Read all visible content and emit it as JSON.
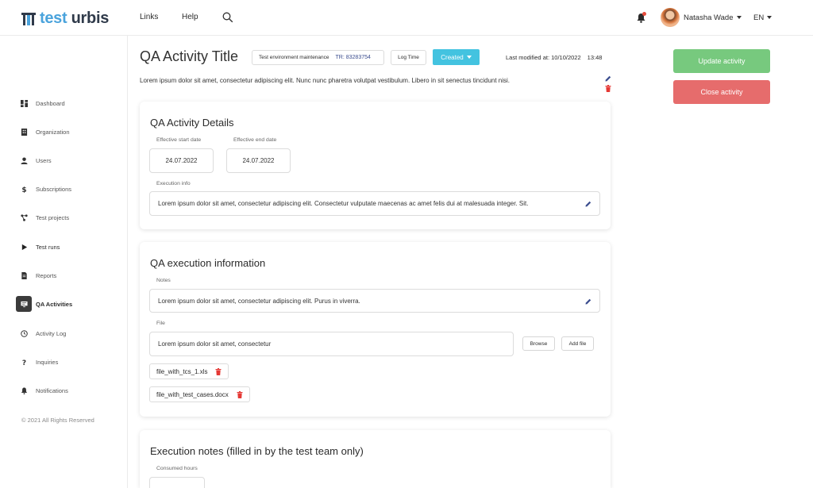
{
  "header": {
    "logo_test": "test",
    "logo_urbis": "urbis",
    "nav": [
      "Links",
      "Help"
    ],
    "user_name": "Natasha Wade",
    "language": "EN"
  },
  "sidebar": {
    "items": [
      {
        "label": "Dashboard",
        "icon": "dashboard-icon"
      },
      {
        "label": "Organization",
        "icon": "building-icon"
      },
      {
        "label": "Users",
        "icon": "user-icon"
      },
      {
        "label": "Subscriptions",
        "icon": "dollar-icon"
      },
      {
        "label": "Test projects",
        "icon": "projects-icon"
      },
      {
        "label": "Test runs",
        "icon": "play-icon"
      },
      {
        "label": "Reports",
        "icon": "report-icon"
      },
      {
        "label": "QA Activities",
        "icon": "monitor-icon",
        "active": true
      },
      {
        "label": "Activity Log",
        "icon": "clock-icon"
      },
      {
        "label": "Inquiries",
        "icon": "question-icon"
      },
      {
        "label": "Notifications",
        "icon": "bell-icon"
      }
    ],
    "copyright": "© 2021 All Rights Reserved"
  },
  "activity": {
    "title": "QA Activity Title",
    "env_label": "Test environment maintenance",
    "tr_label": "TR: 83283754",
    "log_time": "Log Time",
    "status": "Created",
    "last_modified_label": "Last modified at: 10/10/2022",
    "last_modified_time": "13:48",
    "description": "Lorem ipsum dolor sit amet, consectetur adipiscing elit. Nunc nunc pharetra volutpat vestibulum. Libero in sit senectus tincidunt nisi."
  },
  "actions": {
    "update": "Update activity",
    "close": "Close activity"
  },
  "details": {
    "title": "QA Activity Details",
    "start_label": "Effective start date",
    "start_value": "24.07.2022",
    "end_label": "Effective end date",
    "end_value": "24.07.2022",
    "exec_label": "Execution info",
    "exec_value": "Lorem ipsum dolor sit amet, consectetur adipiscing elit. Consectetur vulputate maecenas ac amet felis dui at malesuada integer. Sit."
  },
  "execution": {
    "title": "QA execution information",
    "notes_label": "Notes",
    "notes_value": "Lorem ipsum dolor sit amet, consectetur adipiscing elit. Purus in viverra.",
    "file_label": "File",
    "file_value": "Lorem ipsum dolor sit amet, consectetur",
    "browse": "Browse",
    "add_file": "Add file",
    "files": [
      "file_with_tcs_1.xls",
      "file_with_test_cases.docx"
    ]
  },
  "exec_notes": {
    "title": "Execution notes (filled in by the test team only)",
    "hours_label": "Consumed hours"
  },
  "colors": {
    "accent": "#43c3e0",
    "update": "#77c97e",
    "close": "#e66c6c",
    "logo_blue": "#4aa3dc",
    "trash_red": "#e53935"
  }
}
